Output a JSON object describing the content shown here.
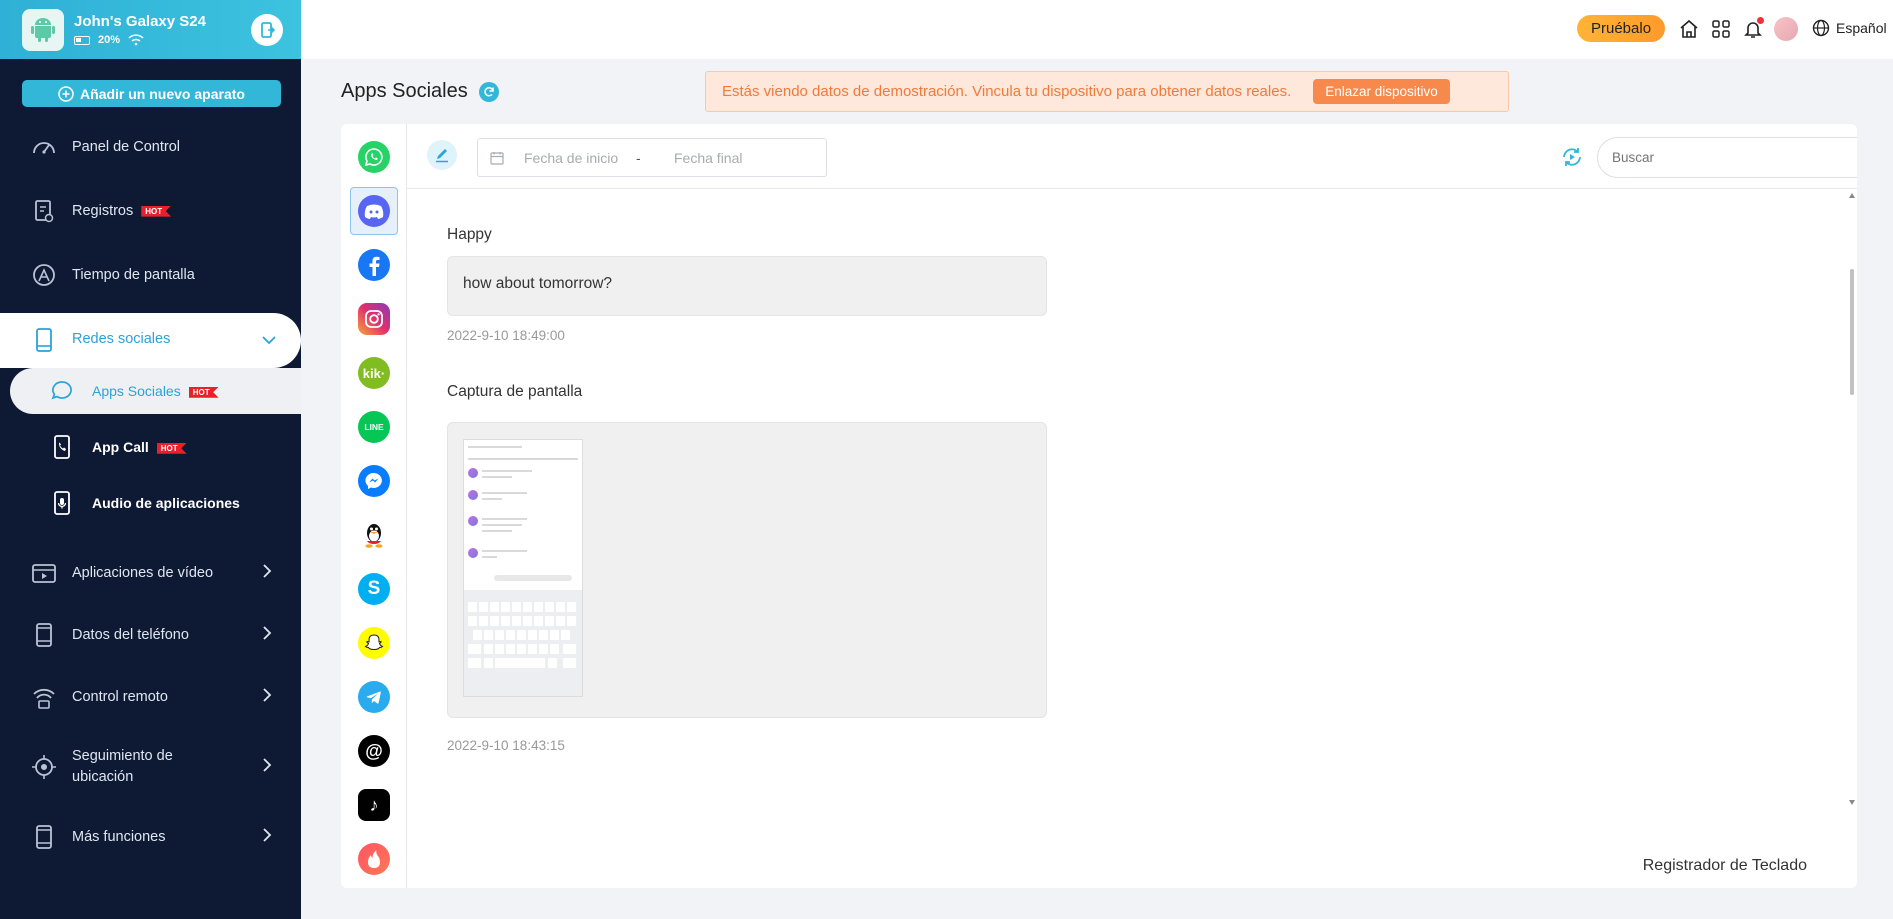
{
  "device": {
    "name": "John's Galaxy S24",
    "battery": "20%"
  },
  "sidebar": {
    "add_device": "Añadir un nuevo aparato",
    "hot_badge": "HOT",
    "items": [
      {
        "label": "Panel de Control",
        "icon": "dashboard-icon"
      },
      {
        "label": "Registros",
        "icon": "records-icon",
        "hot": true
      },
      {
        "label": "Tiempo de pantalla",
        "icon": "screen-time-icon"
      },
      {
        "label": "Redes sociales",
        "icon": "phone-icon",
        "expanded": true
      },
      {
        "label": "Aplicaciones de vídeo",
        "icon": "video-icon"
      },
      {
        "label": "Datos del teléfono",
        "icon": "phone-data-icon"
      },
      {
        "label": "Control remoto",
        "icon": "remote-icon"
      },
      {
        "label": "Seguimiento de ubicación",
        "icon": "location-icon"
      },
      {
        "label": "Más funciones",
        "icon": "more-icon"
      }
    ],
    "submenu": [
      {
        "label": "Apps Sociales",
        "hot": true,
        "active": true
      },
      {
        "label": "App Call",
        "hot": true
      },
      {
        "label": "Audio de aplicaciones",
        "hot": false
      }
    ]
  },
  "header": {
    "try_button": "Pruébalo",
    "language": "Español"
  },
  "page": {
    "title": "Apps Sociales",
    "banner_text": "Estás viendo datos de demostración. Vincula tu dispositivo para obtener datos reales.",
    "banner_button": "Enlazar dispositivo"
  },
  "apps": [
    {
      "name": "WhatsApp",
      "icon": "whatsapp-icon",
      "color": "#25D366"
    },
    {
      "name": "Discord",
      "icon": "discord-icon",
      "color": "#5865F2",
      "active": true
    },
    {
      "name": "Facebook",
      "icon": "facebook-icon",
      "color": "#1877F2"
    },
    {
      "name": "Instagram",
      "icon": "instagram-icon",
      "color": "#E1306C"
    },
    {
      "name": "Kik",
      "icon": "kik-icon",
      "color": "#82BC23",
      "glyph": "kik·"
    },
    {
      "name": "LINE",
      "icon": "line-icon",
      "color": "#06C755",
      "glyph": "LINE"
    },
    {
      "name": "Messenger",
      "icon": "messenger-icon",
      "color": "#0A7CFF"
    },
    {
      "name": "QQ",
      "icon": "qq-icon",
      "color": "#111111"
    },
    {
      "name": "Skype",
      "icon": "skype-icon",
      "color": "#00AFF0",
      "glyph": "S"
    },
    {
      "name": "Snapchat",
      "icon": "snapchat-icon",
      "color": "#FFFC00"
    },
    {
      "name": "Telegram",
      "icon": "telegram-icon",
      "color": "#2AABEE"
    },
    {
      "name": "Threads",
      "icon": "threads-icon",
      "color": "#000000",
      "glyph": "@"
    },
    {
      "name": "TikTok",
      "icon": "tiktok-icon",
      "color": "#010101",
      "glyph": "♪"
    },
    {
      "name": "Tinder",
      "icon": "tinder-icon",
      "color": "#FD5564"
    }
  ],
  "toolbar": {
    "date_start": "Fecha de inicio",
    "date_separator": "-",
    "date_end": "Fecha final",
    "search_placeholder": "Buscar"
  },
  "messages": [
    {
      "sender": "Happy",
      "text": "how about tomorrow?",
      "time": "2022-9-10 18:49:00"
    },
    {
      "sender": "Captura de pantalla",
      "type": "screenshot",
      "time": "2022-9-10 18:43:15"
    }
  ],
  "keylogger_label": "Registrador de Teclado",
  "colors": {
    "sidebar_bg": "#0e1a33",
    "accent": "#33b7d8",
    "banner_text": "#f07a3a",
    "try_button": "#ffa733"
  }
}
